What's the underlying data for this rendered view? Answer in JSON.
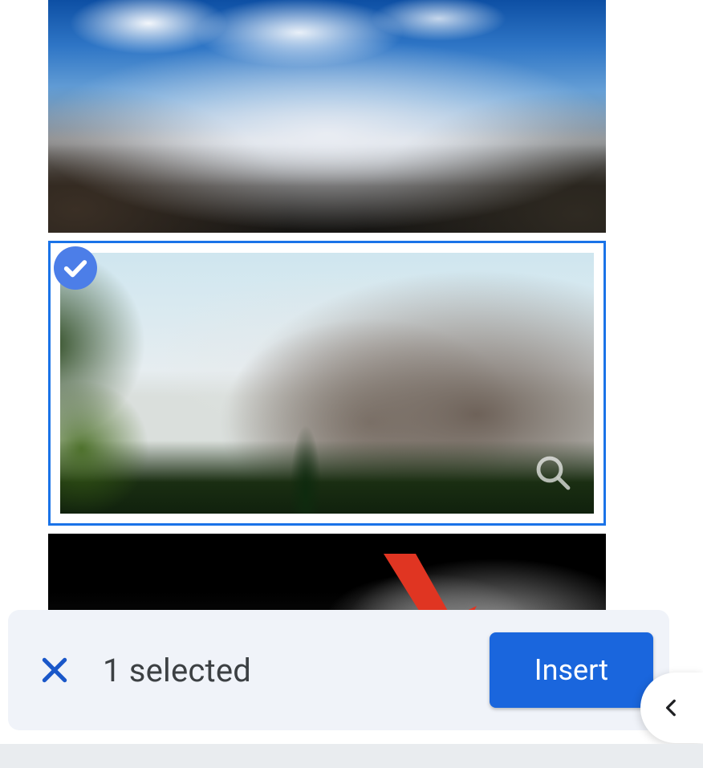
{
  "gallery": {
    "items": [
      {
        "alt": "Snow-capped mountain range under blue sky with clouds",
        "selected": false
      },
      {
        "alt": "Rocky mountain peaks with pine forest valley",
        "selected": true
      },
      {
        "alt": "Dark monochrome mountain in mist",
        "selected": false
      }
    ]
  },
  "selection": {
    "count_text": "1 selected"
  },
  "actions": {
    "insert_label": "Insert"
  },
  "icons": {
    "check": "check-icon",
    "close": "close-icon",
    "magnify": "magnify-icon",
    "chevron_left": "chevron-left-icon"
  },
  "colors": {
    "accent": "#1a73e8",
    "button": "#1a66dd",
    "barBg": "#f0f3f9",
    "annotationArrow": "#e03522"
  }
}
